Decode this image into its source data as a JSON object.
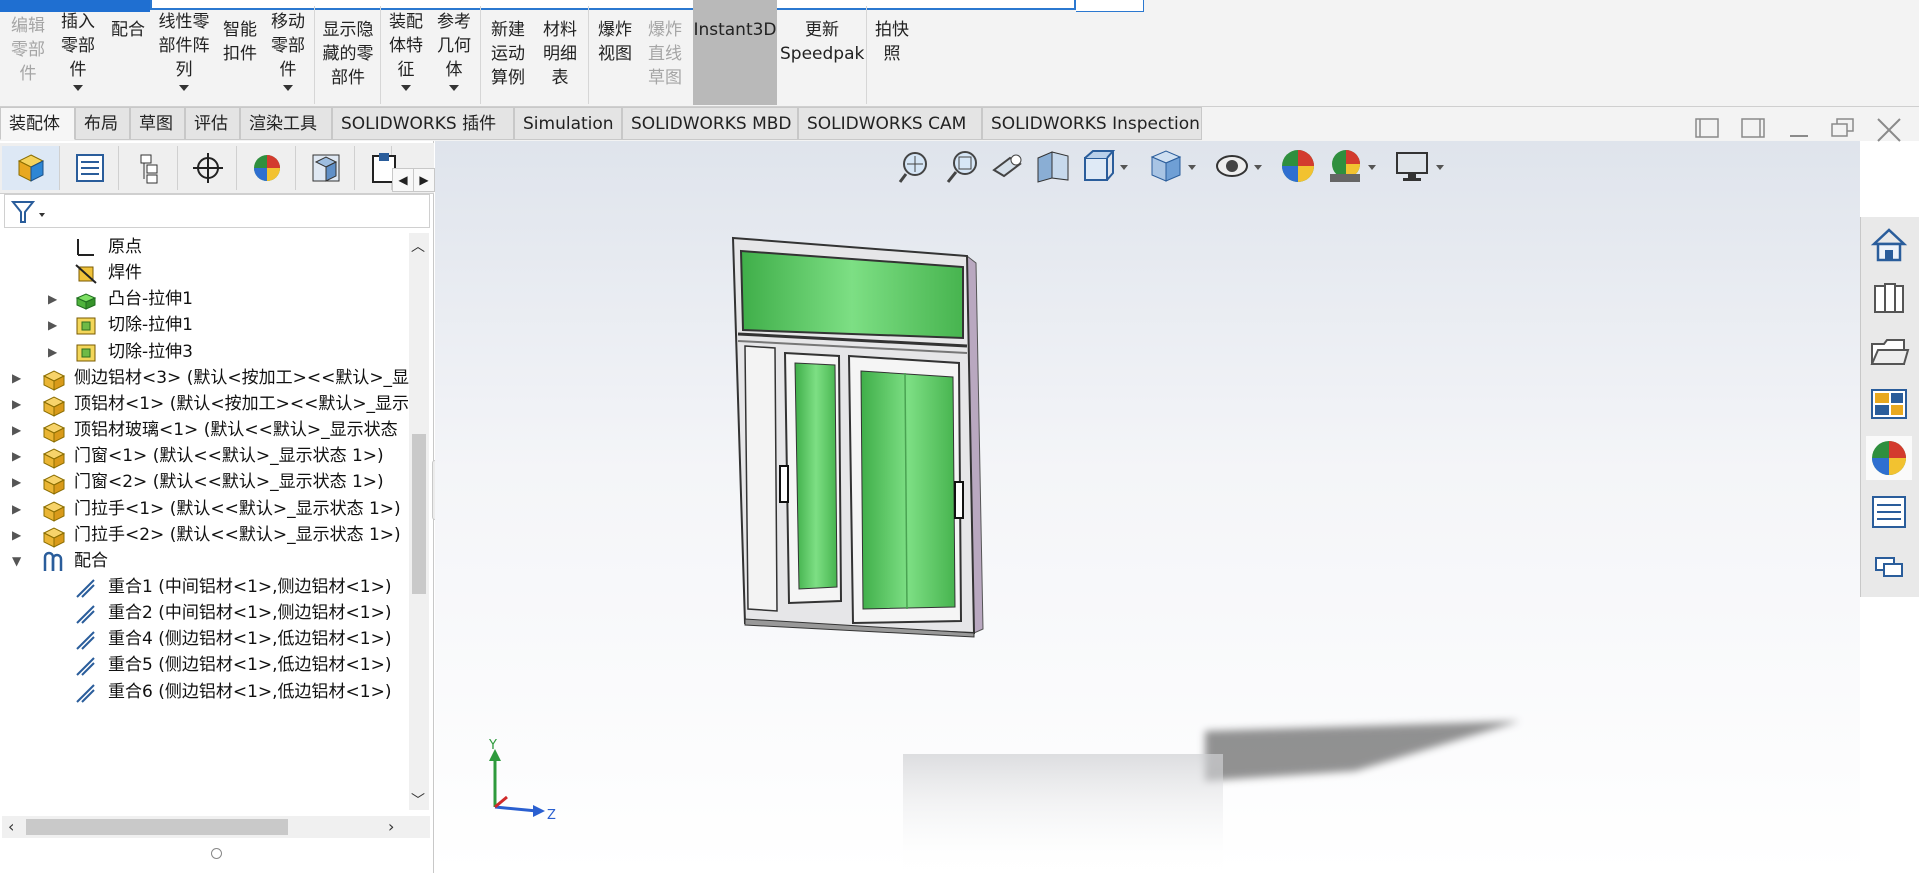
{
  "ribbon": {
    "buttons": [
      {
        "id": "edit-part",
        "label": "编辑\n零部\n件",
        "disabled": true
      },
      {
        "id": "insert-part",
        "label": "插入\n零部\n件",
        "caret": true
      },
      {
        "id": "mate",
        "label": "配合"
      },
      {
        "id": "linear-pattern",
        "label": "线性零\n部件阵\n列",
        "caret": true
      },
      {
        "id": "smart-fastener",
        "label": "智能\n扣件"
      },
      {
        "id": "move-component",
        "label": "移动\n零部\n件",
        "caret": true
      },
      {
        "id": "show-hidden",
        "label": "显示隐\n藏的零\n部件"
      },
      {
        "id": "assembly-feature",
        "label": "装配\n体特\n征",
        "caret": true
      },
      {
        "id": "ref-geometry",
        "label": "参考\n几何\n体",
        "caret": true
      },
      {
        "id": "new-motion-study",
        "label": "新建\n运动\n算例"
      },
      {
        "id": "bom",
        "label": "材料\n明细\n表"
      },
      {
        "id": "exploded-view",
        "label": "爆炸\n视图"
      },
      {
        "id": "explode-line",
        "label": "爆炸\n直线\n草图",
        "disabled": true
      },
      {
        "id": "instant3d",
        "label": "Instant3D",
        "active": true
      },
      {
        "id": "update-speedpak",
        "label": "更新\nSpeedpak"
      },
      {
        "id": "snapshot",
        "label": "拍快\n照"
      }
    ]
  },
  "tabs": [
    {
      "label": "装配体",
      "active": true
    },
    {
      "label": "布局"
    },
    {
      "label": "草图"
    },
    {
      "label": "评估"
    },
    {
      "label": "渲染工具"
    },
    {
      "label": "SOLIDWORKS 插件"
    },
    {
      "label": "Simulation"
    },
    {
      "label": "SOLIDWORKS MBD"
    },
    {
      "label": "SOLIDWORKS CAM"
    },
    {
      "label": "SOLIDWORKS Inspection"
    }
  ],
  "panel_tabs": [
    "featuremanager-icon",
    "propertymanager-icon",
    "configurationmanager-icon",
    "dimxpert-icon",
    "display-manager-icon",
    "cam-feature-icon",
    "cam-operation-icon"
  ],
  "tree": [
    {
      "label": "原点",
      "icon": "origin-icon"
    },
    {
      "label": "焊件",
      "icon": "weldment-icon"
    },
    {
      "label": "凸台-拉伸1",
      "icon": "boss-extrude-icon",
      "expandable": true
    },
    {
      "label": "切除-拉伸1",
      "icon": "cut-extrude-icon",
      "expandable": true
    },
    {
      "label": "切除-拉伸3",
      "icon": "cut-extrude-icon",
      "expandable": true
    },
    {
      "label": "侧边铝材<3> (默认<按加工><<默认>_显",
      "icon": "part-icon",
      "expandable": true
    },
    {
      "label": "顶铝材<1> (默认<按加工><<默认>_显示",
      "icon": "part-icon",
      "expandable": true
    },
    {
      "label": "顶铝材玻璃<1> (默认<<默认>_显示状态",
      "icon": "part-icon",
      "expandable": true
    },
    {
      "label": "门窗<1> (默认<<默认>_显示状态 1>)",
      "icon": "part-icon",
      "expandable": true
    },
    {
      "label": "门窗<2> (默认<<默认>_显示状态 1>)",
      "icon": "part-icon",
      "expandable": true
    },
    {
      "label": "门拉手<1> (默认<<默认>_显示状态 1>)",
      "icon": "part-icon",
      "expandable": true
    },
    {
      "label": "门拉手<2> (默认<<默认>_显示状态 1>)",
      "icon": "part-icon",
      "expandable": true
    },
    {
      "label": "配合",
      "icon": "mates-folder-icon",
      "expanded": true
    },
    {
      "label": "重合1 (中间铝材<1>,侧边铝材<1>)",
      "icon": "coincident-icon"
    },
    {
      "label": "重合2 (中间铝材<1>,侧边铝材<1>)",
      "icon": "coincident-icon"
    },
    {
      "label": "重合4 (侧边铝材<1>,低边铝材<1>)",
      "icon": "coincident-icon"
    },
    {
      "label": "重合5 (侧边铝材<1>,低边铝材<1>)",
      "icon": "coincident-icon"
    },
    {
      "label": "重合6 (侧边铝材<1>,低边铝材<1>)",
      "icon": "coincident-icon"
    }
  ],
  "triad": {
    "x": "",
    "y": "Y",
    "z": "Z"
  },
  "colors": {
    "glass": "#63c96a",
    "frame": "#d8d5dc",
    "active_tab": "#b9b9b9"
  },
  "view_toolbar": [
    "zoom-to-fit-icon",
    "zoom-to-area-icon",
    "previous-view-icon",
    "section-view-icon",
    "view-orientation-icon",
    "display-style-icon",
    "hide-show-icon",
    "edit-appearance-icon",
    "apply-scene-icon",
    "view-settings-icon"
  ],
  "task_pane": [
    "solidworks-resources-icon",
    "design-library-icon",
    "file-explorer-icon",
    "view-palette-icon",
    "appearances-icon",
    "custom-properties-icon",
    "forum-icon"
  ]
}
